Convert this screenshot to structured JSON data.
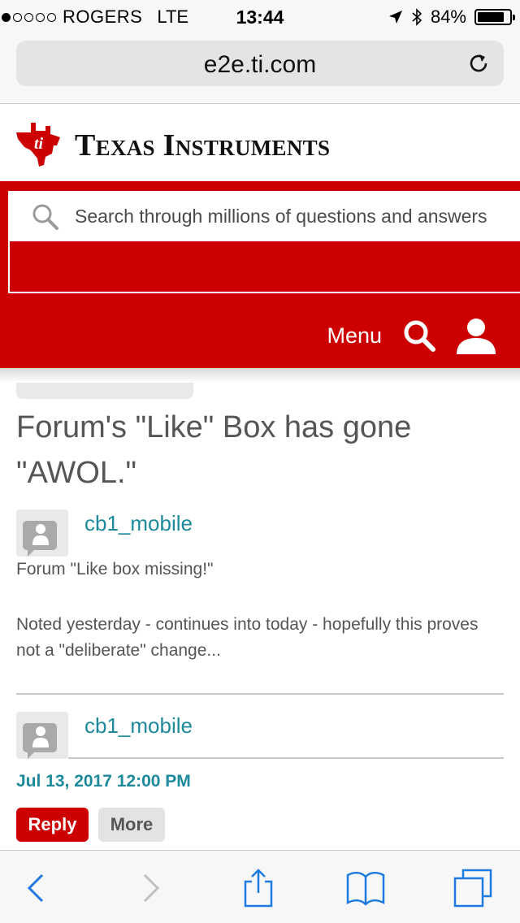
{
  "status_bar": {
    "signal_dots_filled": 1,
    "signal_dots_total": 5,
    "carrier": "ROGERS",
    "network": "LTE",
    "time": "13:44",
    "battery_percent_label": "84%",
    "battery_level": 0.84
  },
  "browser": {
    "url": "e2e.ti.com",
    "reload_icon": "reload-icon"
  },
  "site": {
    "brand": "Texas Instruments",
    "logo_icon": "ti-logo-icon",
    "accent_color": "#cc0000",
    "link_color": "#1d8a9c",
    "search_placeholder": "Search through millions of questions and answers",
    "menu_label": "Menu",
    "search_icon": "search-icon",
    "user_icon": "user-icon"
  },
  "thread": {
    "title": "Forum's \"Like\" Box has gone \"AWOL.\"",
    "posts": [
      {
        "author": "cb1_mobile",
        "paragraphs": [
          "Forum \"Like box missing!\"",
          "Noted yesterday - continues into today - hopefully this proves not a \"deliberate\" change..."
        ]
      },
      {
        "author": "cb1_mobile",
        "date": "Jul 13, 2017 12:00 PM",
        "reply_label": "Reply",
        "more_label": "More"
      }
    ]
  },
  "toolbar": {
    "items": [
      "back-icon",
      "forward-icon",
      "share-icon",
      "bookmarks-icon",
      "tabs-icon"
    ]
  }
}
